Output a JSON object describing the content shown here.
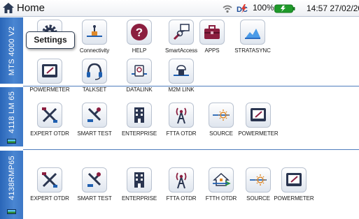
{
  "titlebar": {
    "title": "Home",
    "battery_percent": "100%",
    "clock": "14:57 27/02/2018",
    "icons": [
      "home-icon",
      "wifi-icon",
      "dc-power-icon",
      "battery-icon"
    ]
  },
  "tooltip": {
    "text": "Settings"
  },
  "sections": [
    {
      "label": "MTS 4000 V2",
      "apps": [
        {
          "label": "Settings",
          "icon": "gear-icon"
        },
        {
          "label": "Connectivity",
          "icon": "connectivity-icon"
        },
        {
          "label": "HELP",
          "icon": "help-icon"
        },
        {
          "label": "SmartAccess",
          "icon": "smartaccess-icon"
        },
        {
          "label": "APPS",
          "icon": "toolbox-icon"
        },
        {
          "label": "STRATASYNC",
          "icon": "cloud-icon"
        },
        {
          "label": "POWERMETER",
          "icon": "gauge-icon"
        },
        {
          "label": "TALKSET",
          "icon": "headset-icon"
        },
        {
          "label": "DATALINK",
          "icon": "datalink-icon"
        },
        {
          "label": "M2M LINK",
          "icon": "m2m-link-icon"
        }
      ]
    },
    {
      "label": "4118 LM 65",
      "apps": [
        {
          "label": "EXPERT OTDR",
          "icon": "expert-otdr-icon"
        },
        {
          "label": "SMART TEST",
          "icon": "smart-test-icon"
        },
        {
          "label": "ENTERPRISE",
          "icon": "building-icon"
        },
        {
          "label": "FTTA OTDR",
          "icon": "antenna-icon"
        },
        {
          "label": "SOURCE",
          "icon": "light-source-icon"
        },
        {
          "label": "POWERMETER",
          "icon": "gauge-icon"
        }
      ]
    },
    {
      "label": "4138RMP65",
      "apps": [
        {
          "label": "EXPERT OTDR",
          "icon": "expert-otdr-icon"
        },
        {
          "label": "SMART TEST",
          "icon": "smart-test-icon"
        },
        {
          "label": "ENTERPRISE",
          "icon": "building-icon"
        },
        {
          "label": "FTTA OTDR",
          "icon": "antenna-icon"
        },
        {
          "label": "FTTH OTDR",
          "icon": "house-fiber-icon"
        },
        {
          "label": "SOURCE",
          "icon": "light-source-icon"
        },
        {
          "label": "POWERMETER",
          "icon": "gauge-icon"
        }
      ]
    }
  ],
  "colors": {
    "strip": "#3a76c6",
    "icon_red": "#8b1e3f",
    "icon_blue": "#1f5fb0",
    "icon_dark": "#2a3550"
  }
}
